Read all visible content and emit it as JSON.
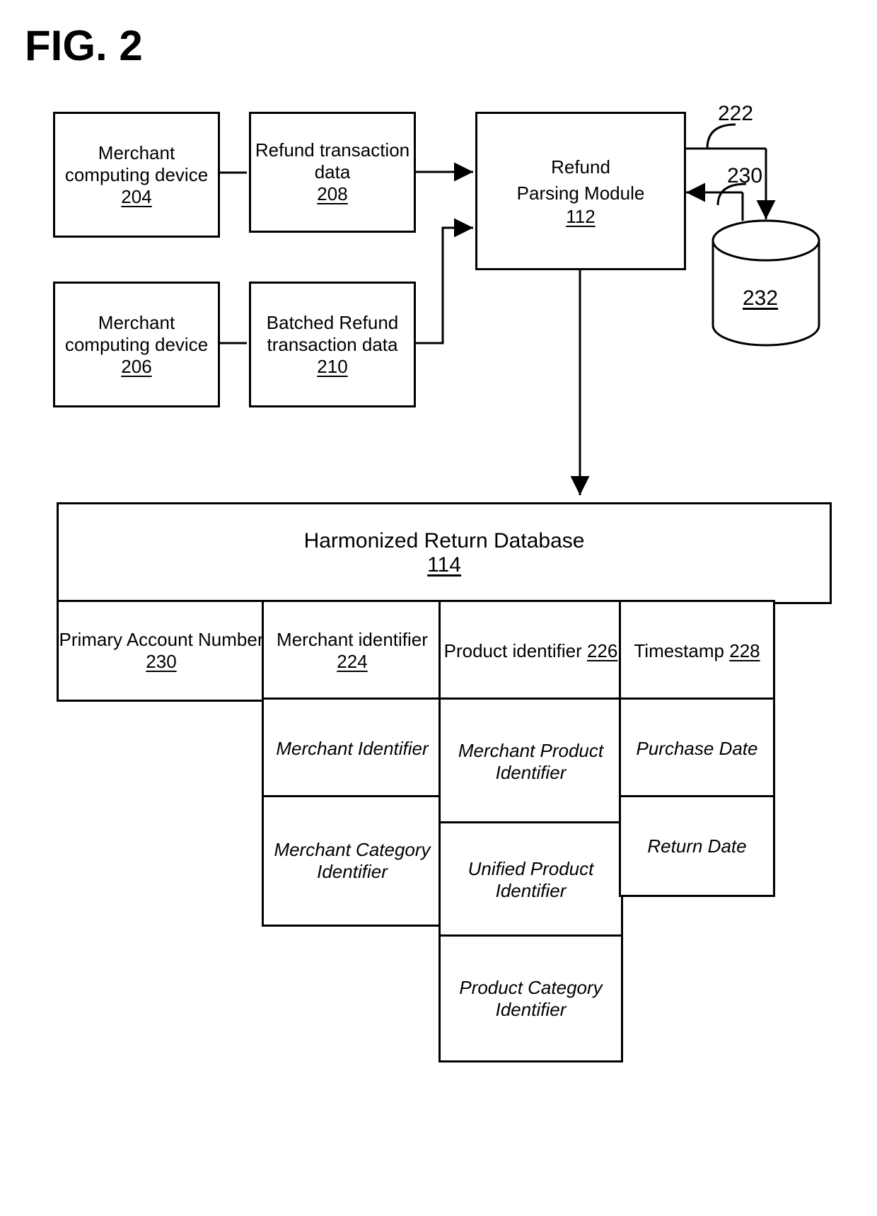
{
  "figure": {
    "label": "FIG. 2"
  },
  "boxes": {
    "merch_dev1": {
      "title": "Merchant computing device",
      "ref": "204"
    },
    "merch_dev2": {
      "title": "Merchant computing device",
      "ref": "206"
    },
    "refund_data": {
      "title": "Refund transaction data",
      "ref": "208"
    },
    "batched_data": {
      "title": "Batched Refund transaction data",
      "ref": "210"
    },
    "refund_module": {
      "title": "Refund Parsing Module",
      "ref": "112"
    }
  },
  "cylinder": {
    "ref": "232"
  },
  "callouts": {
    "c222": "222",
    "c230": "230"
  },
  "database": {
    "title": "Harmonized Return Database",
    "ref": "114",
    "columns": {
      "pan": {
        "header_title": "Primary Account Number",
        "header_ref": "230"
      },
      "mid": {
        "header_title": "Merchant identifier",
        "header_ref": "224",
        "rows": [
          "Merchant Identifier",
          "Merchant Category Identifier"
        ]
      },
      "pid": {
        "header_title": "Product identifier",
        "header_ref": "226",
        "rows": [
          "Merchant Product Identifier",
          "Unified Product Identifier",
          "Product Category Identifier"
        ]
      },
      "ts": {
        "header_title": "Timestamp",
        "header_ref": "228",
        "rows": [
          "Purchase Date",
          "Return Date"
        ]
      }
    }
  }
}
